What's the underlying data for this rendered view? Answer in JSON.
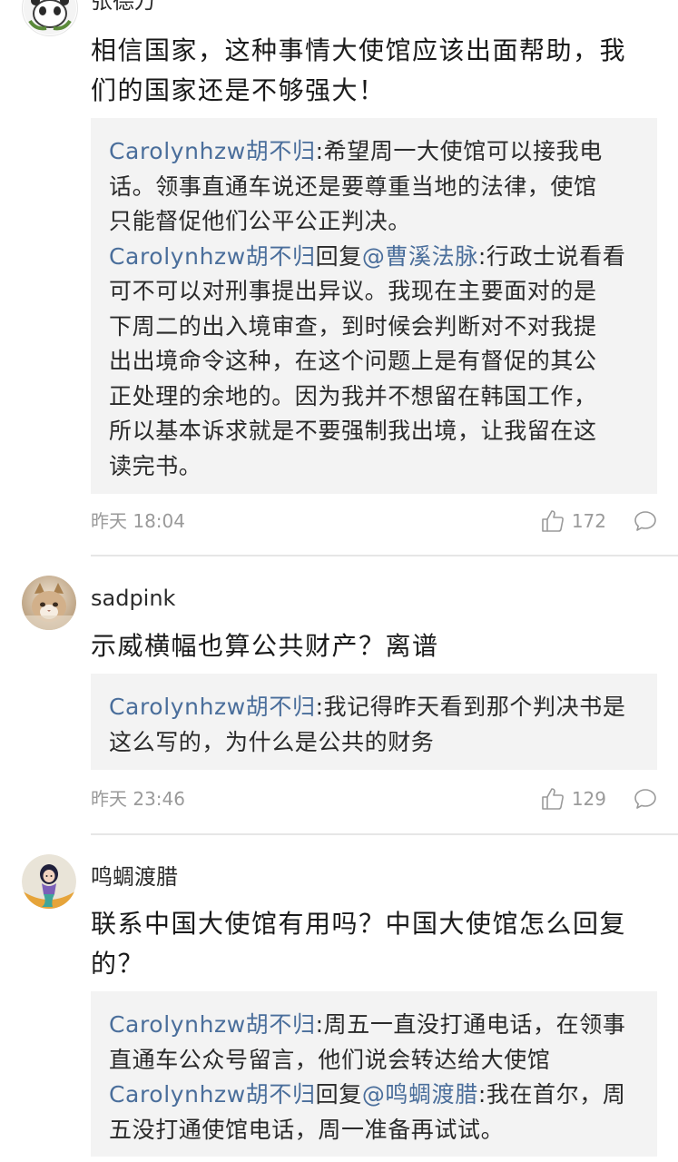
{
  "comments": [
    {
      "username": "张德万",
      "text_lines": [
        "相信国家，这种事情大使馆应该出面帮助，我",
        "们的国家还是不够强大！"
      ],
      "replies": [
        {
          "user": "Carolynhzw胡不归",
          "reply_prefix": "",
          "reply_to": "",
          "text_lines": [
            ":希望周一大使馆可以接我电",
            "话。领事直通车说还是要尊重当地的法律，使馆",
            "只能督促他们公平公正判决。"
          ]
        },
        {
          "user": "Carolynhzw胡不归",
          "reply_prefix": "回复",
          "reply_to": "@曹溪法脉",
          "text_lines": [
            ":行政士说看看",
            "可不可以对刑事提出异议。我现在主要面对的是",
            "下周二的出入境审查，到时候会判断对不对我提",
            "出出境命令这种，在这个问题上是有督促的其公",
            "正处理的余地的。因为我并不想留在韩国工作，",
            "所以基本诉求就是不要强制我出境，让我留在这",
            "读完书。"
          ]
        }
      ],
      "timestamp": "昨天 18:04",
      "likes": "172"
    },
    {
      "username": "sadpink",
      "text_lines": [
        "示威横幅也算公共财产？离谱"
      ],
      "replies": [
        {
          "user": "Carolynhzw胡不归",
          "reply_prefix": "",
          "reply_to": "",
          "text_lines": [
            ":我记得昨天看到那个判决书是",
            "这么写的，为什么是公共的财务"
          ]
        }
      ],
      "timestamp": "昨天 23:46",
      "likes": "129"
    },
    {
      "username": "鸣蜩渡腊",
      "text_lines": [
        "联系中国大使馆有用吗？中国大使馆怎么回复",
        "的？"
      ],
      "replies": [
        {
          "user": "Carolynhzw胡不归",
          "reply_prefix": "",
          "reply_to": "",
          "text_lines": [
            ":周五一直没打通电话，在领事",
            "直通车公众号留言，他们说会转达给大使馆"
          ]
        },
        {
          "user": "Carolynhzw胡不归",
          "reply_prefix": "回复",
          "reply_to": "@鸣蜩渡腊",
          "text_lines": [
            ":我在首尔，周",
            "五没打通使馆电话，周一准备再试试。"
          ]
        }
      ]
    }
  ],
  "colors": {
    "link": "#4a6e9b",
    "reply_bg": "#f3f3f3",
    "meta_text": "#9a9a9a",
    "divider": "#e6e6e6"
  },
  "icons": {
    "like": "thumbs-up-icon",
    "reply": "speech-bubble-icon"
  }
}
